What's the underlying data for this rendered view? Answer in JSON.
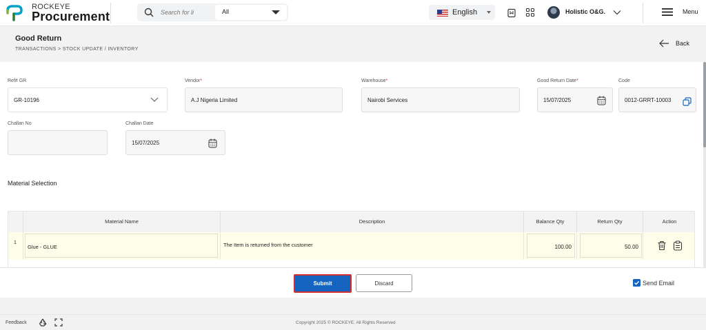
{
  "app": {
    "brand_small": "ROCKEYE",
    "brand_big": "Procurement"
  },
  "search": {
    "placeholder": "Search for li",
    "scope_value": "All"
  },
  "topbar": {
    "language": "English",
    "user_name": "Holistic O&G.",
    "menu_label": "Menu"
  },
  "header": {
    "title": "Good Return",
    "breadcrumb": "TRANSACTIONS >  STOCK UPDATE / INVENTORY",
    "back_label": "Back"
  },
  "form": {
    "ref_label": "Ref# GR",
    "ref_value": "GR-10196",
    "vendor_label": "Vendor",
    "vendor_value": "A.J Nigeria Limited",
    "warehouse_label": "Warehouse",
    "warehouse_value": "Nairobi Services",
    "return_date_label": "Good Return Date",
    "return_date_value": "15/07/2025",
    "code_label": "Code",
    "code_value": "0012-GRRT-10003",
    "challan_no_label": "Challan No",
    "challan_no_value": "",
    "challan_date_label": "Challan Date",
    "challan_date_value": "15/07/2025",
    "required_mark": "*"
  },
  "materials": {
    "section_title": "Material Selection",
    "columns": [
      "Material Name",
      "Description",
      "Balance Qty",
      "Return Qty",
      "Action"
    ],
    "rows": [
      {
        "num": "1",
        "material": "Glue - GLUE",
        "description": "The Item is returned from the customer",
        "balance_qty": "100.00",
        "return_qty": "50.00"
      }
    ]
  },
  "actions": {
    "submit": "Submit",
    "discard": "Discard",
    "send_email": "Send Email",
    "send_email_checked": true
  },
  "footer": {
    "feedback": "Feedback",
    "copyright": "Copyright 2025 © ROCKEYE. All Rights Reserved"
  },
  "colors": {
    "primary": "#1565c0",
    "highlight": "#d32f2f",
    "row_bg": "#fdfde9"
  }
}
